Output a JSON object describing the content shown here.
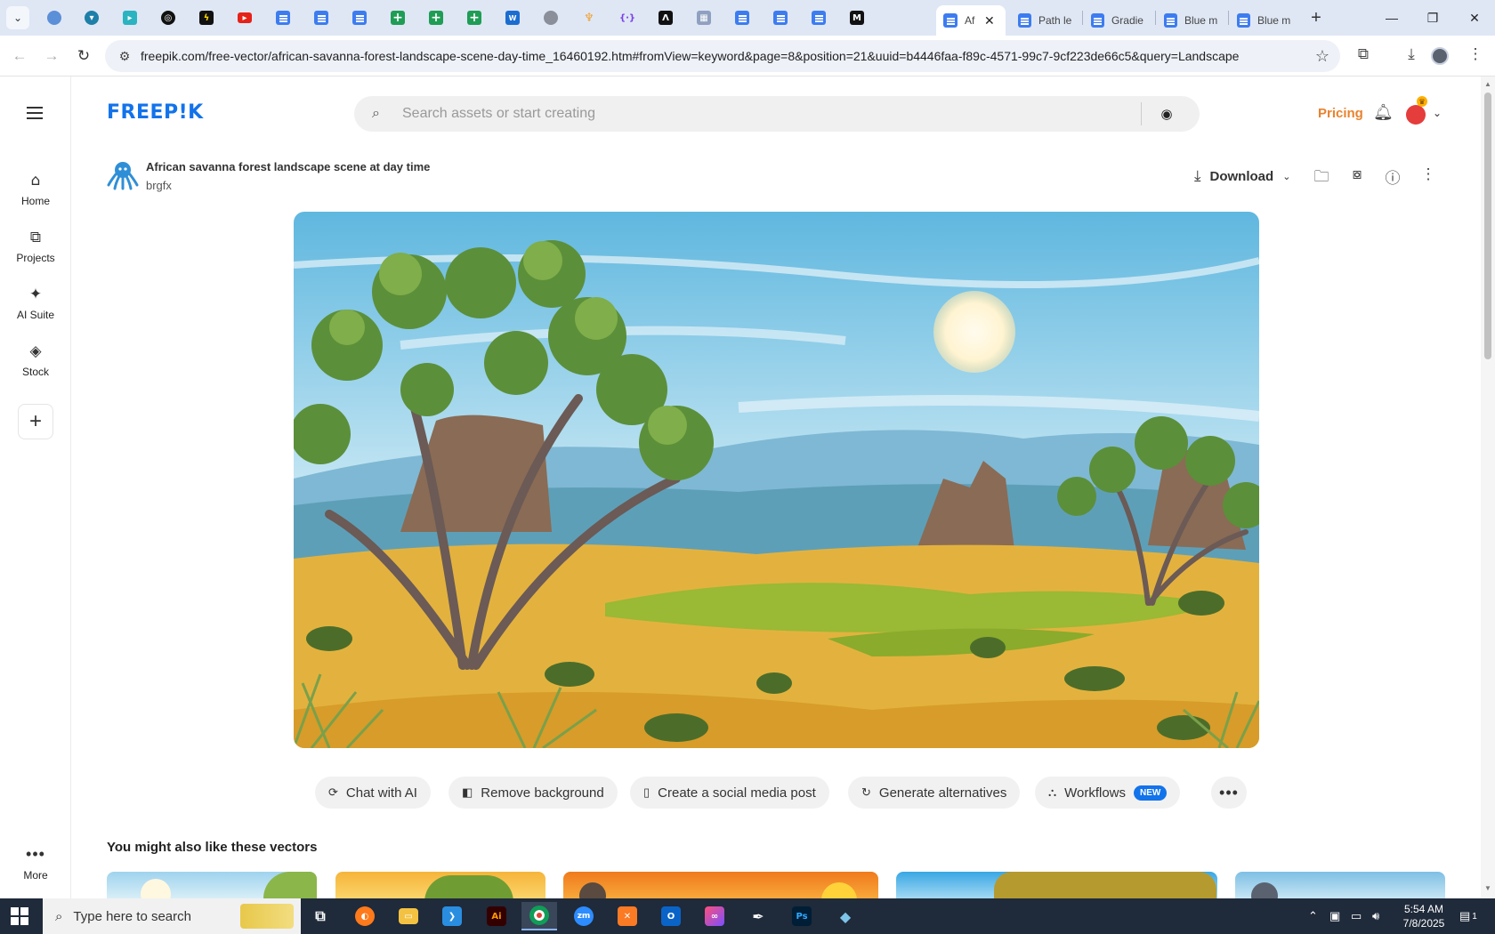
{
  "browser": {
    "tabs": [
      {
        "label": "Af",
        "active": true
      },
      {
        "label": "Path le",
        "active": false
      },
      {
        "label": "Gradie",
        "active": false
      },
      {
        "label": "Blue m",
        "active": false
      },
      {
        "label": "Blue m",
        "active": false
      }
    ],
    "url": "freepik.com/free-vector/african-savanna-forest-landscape-scene-day-time_16460192.htm#fromView=keyword&page=8&position=21&uuid=b4446faa-f89c-4571-99c7-9cf223de66c5&query=Landscape"
  },
  "sidebar": {
    "items": [
      {
        "label": "Home",
        "icon": "home-icon"
      },
      {
        "label": "Projects",
        "icon": "projects-icon"
      },
      {
        "label": "AI Suite",
        "icon": "sparkle-icon"
      },
      {
        "label": "Stock",
        "icon": "stock-icon"
      }
    ],
    "more_label": "More"
  },
  "header": {
    "logo": "FREEP!K",
    "search_placeholder": "Search assets or start creating",
    "pricing": "Pricing"
  },
  "asset": {
    "title": "African savanna forest landscape scene at day time",
    "author": "brgfx",
    "download_label": "Download"
  },
  "actions": [
    {
      "label": "Chat with AI",
      "icon": "chat-icon"
    },
    {
      "label": "Remove background",
      "icon": "remove-bg-icon"
    },
    {
      "label": "Create a social media post",
      "icon": "phone-icon"
    },
    {
      "label": "Generate alternatives",
      "icon": "refresh-icon"
    },
    {
      "label": "Workflows",
      "icon": "workflow-icon",
      "badge": "NEW"
    }
  ],
  "related": {
    "title": "You might also like these vectors"
  },
  "taskbar": {
    "search_placeholder": "Type here to search",
    "time": "5:54 AM",
    "date": "7/8/2025",
    "notification_count": "1"
  },
  "colors": {
    "brand": "#1273eb",
    "pricing": "#e9822f",
    "badge": "#1273eb"
  }
}
